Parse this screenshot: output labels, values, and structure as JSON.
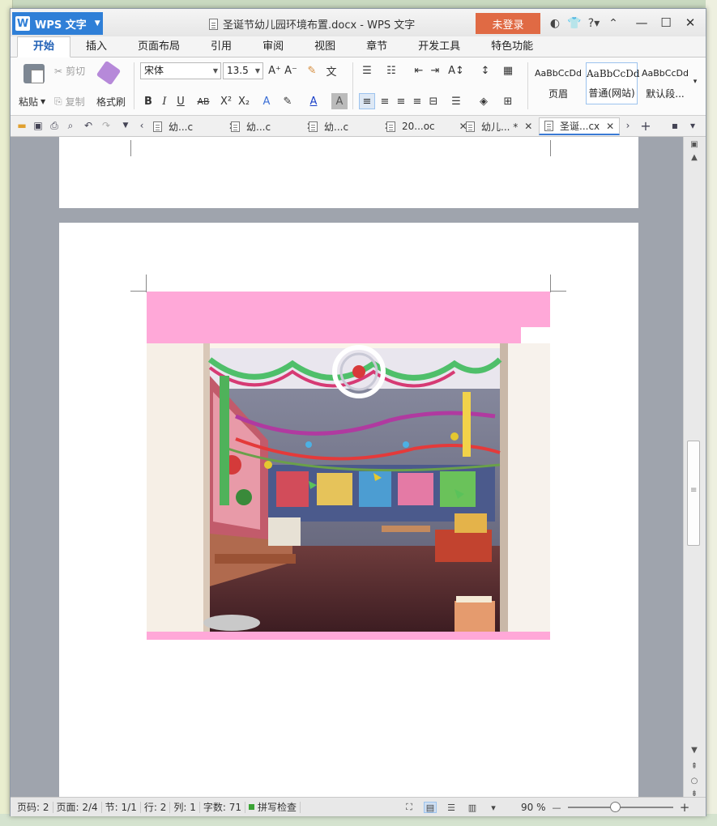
{
  "app": {
    "name": "WPS 文字",
    "window_title": "圣诞节幼儿园环境布置.docx - WPS 文字",
    "login_label": "未登录"
  },
  "ribbon_tabs": [
    "开始",
    "插入",
    "页面布局",
    "引用",
    "审阅",
    "视图",
    "章节",
    "开发工具",
    "特色功能"
  ],
  "ribbon": {
    "paste_label": "粘贴",
    "cut_label": "剪切",
    "copy_label": "复制",
    "format_painter_label": "格式刷",
    "font_name": "宋体",
    "font_size": "13.5",
    "styles": [
      {
        "sample": "AaBbCcDd",
        "label": "页眉"
      },
      {
        "sample": "AaBbCcDd",
        "label": "普通(网站)"
      },
      {
        "sample": "AaBbCcDd",
        "label": "默认段..."
      }
    ]
  },
  "doc_tabs": [
    {
      "label": "幼...c",
      "active": false
    },
    {
      "label": "幼...c",
      "active": false
    },
    {
      "label": "幼...c",
      "active": false
    },
    {
      "label": "20...oc",
      "active": false
    },
    {
      "label": "幼儿... *",
      "active": false
    },
    {
      "label": "圣诞...cx",
      "active": true
    }
  ],
  "status": {
    "page_num": "页码: 2",
    "pages": "页面: 2/4",
    "section": "节: 1/1",
    "row": "行: 2",
    "col": "列: 1",
    "word_count": "字数: 71",
    "spell_check": "拼写检查",
    "zoom": "90 %"
  },
  "colors": {
    "accent": "#2f7fd7",
    "login": "#e06a44",
    "pink_block": "#ffa8d8",
    "doc_bg": "#9fa4ad"
  }
}
